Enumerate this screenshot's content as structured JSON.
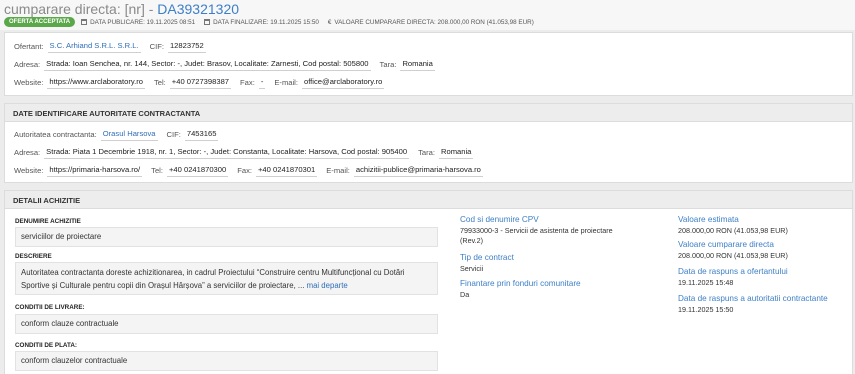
{
  "header": {
    "title_prefix": "cumparare directa: [nr] -",
    "code": "DA39321320",
    "badge": "OFERTA ACCEPTATA",
    "data_publicare": "DATA PUBLICARE: 19.11.2025 08:51",
    "data_finalizare": "DATA FINALIZARE: 19.11.2025 15:50",
    "valoare": "VALOARE CUMPARARE DIRECTA: 208.000,00   RON (41.053,98   EUR)"
  },
  "ofertant": {
    "ofertant_label": "Ofertant:",
    "ofertant": "S.C. Arhiand S.R.L. S.R.L.",
    "cif_label": "CIF:",
    "cif": "12823752",
    "adresa_label": "Adresa:",
    "adresa": "Strada: Ioan Senchea, nr. 144, Sector: -, Judet: Brasov, Localitate: Zarnesti, Cod postal: 505800",
    "tara_label": "Tara:",
    "tara": "Romania",
    "website_label": "Website:",
    "website": "https://www.arclaboratory.ro",
    "tel_label": "Tel:",
    "tel": "+40 0727398387",
    "fax_label": "Fax:",
    "fax": "-",
    "email_label": "E-mail:",
    "email": "office@arclaboratory.ro"
  },
  "autoritate": {
    "heading": "DATE IDENTIFICARE AUTORITATE CONTRACTANTA",
    "autoritate_label": "Autoritatea contractanta:",
    "autoritate": "Orasul Harsova",
    "cif_label": "CIF:",
    "cif": "7453165",
    "adresa_label": "Adresa:",
    "adresa": "Strada: Piata 1 Decembrie 1918, nr. 1, Sector: -, Judet: Constanta, Localitate: Harsova, Cod postal: 905400",
    "tara_label": "Tara:",
    "tara": "Romania",
    "website_label": "Website:",
    "website": "https://primaria-harsova.ro/",
    "tel_label": "Tel:",
    "tel": "+40 0241870300",
    "fax_label": "Fax:",
    "fax": "+40 0241870301",
    "email_label": "E-mail:",
    "email": "achizitii-publice@primaria-harsova.ro"
  },
  "detalii": {
    "heading": "DETALII ACHIZITIE",
    "denumire_label": "DENUMIRE ACHIZITIE",
    "denumire": "serviciilor de proiectare",
    "descriere_label": "DESCRIERE",
    "descriere_line1": "Autoritatea contractanta doreste achizitionarea, in cadrul Proiectului “Construire centru Multifuncțional cu Dotări",
    "descriere_line2": "Sportive și Culturale pentru copii din Orașul Hârșova” a serviciilor de proiectare, ...",
    "mai_departe": "mai departe",
    "livrare_label": "CONDITII DE LIVRARE:",
    "livrare": "conform clauze contractuale",
    "plata_label": "CONDITII DE PLATA:",
    "plata": "conform clauzelor contractuale",
    "cpv_label": "Cod si denumire CPV",
    "cpv_line1": "79933000-3 - Servicii de asistenta de proiectare",
    "cpv_line2": "(Rev.2)",
    "tip_label": "Tip de contract",
    "tip": "Servicii",
    "fonduri_label": "Finantare prin fonduri comunitare",
    "fonduri": "Da",
    "estimata_label": "Valoare estimata",
    "estimata": "208.000,00   RON (41.053,98   EUR)",
    "cumparare_label": "Valoare cumparare directa",
    "cumparare": "208.000,00   RON (41.053,98   EUR)",
    "raspuns_ofertant_label": "Data de raspuns a ofertantului",
    "raspuns_ofertant": "19.11.2025 15:48",
    "raspuns_autoritate_label": "Data de raspuns a autoritatii contractante",
    "raspuns_autoritate": "19.11.2025 15:50"
  }
}
